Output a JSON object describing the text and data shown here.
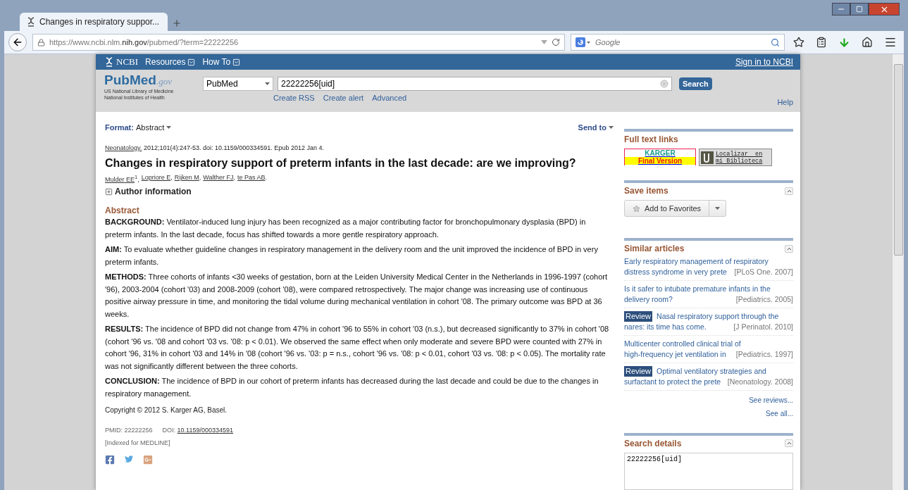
{
  "browser": {
    "tabs": [
      {
        "title": "Changes in respiratory suppor...",
        "selected": true
      }
    ],
    "url": "https://www.ncbi.nlm.**nih.gov**/pubmed/?term=22222256",
    "search_placeholder": "Google"
  },
  "ncbi_bar": {
    "logo": "NCBI",
    "menus": [
      "Resources",
      "How To"
    ],
    "sign_in": "Sign in to NCBI"
  },
  "header": {
    "logo_main": "PubMed",
    "logo_suffix": ".gov",
    "logo_lines": [
      "US National Library of Medicine",
      "National Institutes of Health"
    ],
    "database": "PubMed",
    "query": "22222256[uid]",
    "search_button": "Search",
    "links": [
      "Create RSS",
      "Create alert",
      "Advanced"
    ],
    "help": "Help"
  },
  "article": {
    "format_label": "Format:",
    "format_value": "Abstract",
    "send_to": "Send to",
    "journal": "Neonatology.",
    "citation": " 2012;101(4):247-53. doi: 10.1159/000334591. Epub 2012 Jan 4.",
    "title": "Changes in respiratory support of preterm infants in the last decade: are we improving?",
    "authors": [
      {
        "name": "Mulder EE",
        "sup": "1",
        "sep": ","
      },
      {
        "name": "Lopriore E",
        "sep": ","
      },
      {
        "name": "Rijken M",
        "sep": ","
      },
      {
        "name": "Walther FJ",
        "sep": ","
      },
      {
        "name": "te Pas AB",
        "sep": "."
      }
    ],
    "author_info": {
      "label": "Author information",
      "expanded": false
    },
    "abstract_heading": "Abstract",
    "sections": [
      "**BACKGROUND:** Ventilator-induced lung injury has been recognized as a major contributing factor for bronchopulmonary dysplasia (BPD) in preterm infants. In the last decade, focus has shifted towards a more gentle respiratory approach.",
      "**AIM:** To evaluate whether guideline changes in respiratory management in the delivery room and the unit improved the incidence of BPD in very preterm infants.",
      "**METHODS:** Three cohorts of infants <30 weeks of gestation, born at the Leiden University Medical Center in the Netherlands in 1996-1997 (cohort '96), 2003-2004 (cohort '03) and 2008-2009 (cohort '08), were compared retrospectively. The major change was increasing use of continuous positive airway pressure in time, and monitoring the tidal volume during mechanical ventilation in cohort '08. The primary outcome was BPD at 36 weeks.",
      "**RESULTS:** The incidence of BPD did not change from 47% in cohort '96 to 55% in cohort '03 (n.s.), but decreased significantly to 37% in cohort '08 (cohort '96 vs. '08 and cohort '03 vs. '08: p < 0.01). We observed the same effect when only moderate and severe BPD were counted with 27% in cohort '96, 31% in cohort '03 and 14% in '08 (cohort '96 vs. '03: p = n.s., cohort '96 vs. '08: p < 0.01, cohort '03 vs. '08: p < 0.05). The mortality rate was not significantly different between the three cohorts.",
      "**CONCLUSION:** The incidence of BPD in our cohort of preterm infants has decreased during the last decade and could be due to the changes in respiratory management."
    ],
    "copyright": "Copyright © 2012 S. Karger AG, Basel.",
    "pmid": "PMID: 22222256",
    "doi_label": "DOI:",
    "doi": "10.1159/000334591",
    "indexed": "[Indexed for MEDLINE]"
  },
  "sidebar": {
    "full_text_heading": "Full text links",
    "karger": [
      "KARGER",
      "Final Version"
    ],
    "library": [
      "Localizar  en",
      "mi Biblioteca"
    ],
    "save_heading": "Save items",
    "favorites": "Add to Favorites",
    "similar_heading": "Similar articles",
    "similar": [
      {
        "title_lines": [
          "Early respiratory management of respiratory",
          "distress syndrome in very prete"
        ],
        "source": "[PLoS One. 2007]"
      },
      {
        "title_lines": [
          "Is it safer to intubate premature infants in the",
          "delivery room?"
        ],
        "source": "[Pediatrics. 2005]"
      },
      {
        "badge": "Review",
        "title_lines": [
          "Nasal respiratory support through the",
          "nares: its time has come."
        ],
        "source": "[J Perinatol. 2010]"
      },
      {
        "title_lines": [
          "Multicenter controlled clinical trial of",
          "high-frequency jet ventilation in"
        ],
        "source": "[Pediatrics. 1997]"
      },
      {
        "badge": "Review",
        "title_lines": [
          "Optimal ventilatory strategies and",
          "surfactant to protect the prete"
        ],
        "source": "[Neonatology. 2008]"
      }
    ],
    "see_reviews": "See reviews...",
    "see_all": "See all...",
    "details_heading": "Search details",
    "details_query": "22222256[uid]"
  }
}
